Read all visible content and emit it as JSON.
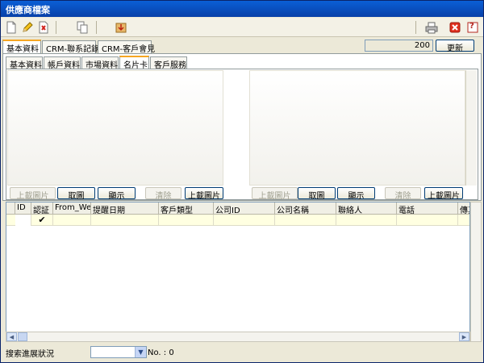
{
  "window": {
    "title": "供應商檔案"
  },
  "toolbar": {
    "icons": [
      "new-document-icon",
      "edit-pencil-icon",
      "delete-doc-icon",
      "copy-icon",
      "import-icon",
      "print-icon",
      "close-icon",
      "help-icon"
    ],
    "help_glyph": "?"
  },
  "top_tabs": [
    {
      "label": "基本資料",
      "active": true
    },
    {
      "label": "CRM-聯系記錄",
      "active": false
    },
    {
      "label": "CRM-客戶會見",
      "active": false
    }
  ],
  "top_field": {
    "value": "200"
  },
  "top_refresh_label": "更新",
  "inner_tabs": [
    {
      "label": "基本資料",
      "active": false
    },
    {
      "label": "帳戶資料",
      "active": false
    },
    {
      "label": "市場資料",
      "active": false
    },
    {
      "label": "名片卡",
      "active": true
    },
    {
      "label": "客戶服務",
      "active": false
    }
  ],
  "card_buttons": {
    "upload_disabled": "上載圖片",
    "retrieve": "取圖",
    "show": "顯示",
    "clear": "清除",
    "upload": "上載圖片"
  },
  "grid": {
    "columns": [
      "ID",
      "認証",
      "From_Web",
      "提醒日期",
      "客戶類型",
      "公司ID",
      "公司名稱",
      "聯絡人",
      "電話",
      "傳真"
    ],
    "rows": [
      {
        "id": "",
        "verified": "✔",
        "from_web": "",
        "remind_date": "",
        "client_type": "",
        "company_id": "",
        "company_name": "",
        "contact": "",
        "phone": "",
        "fax": ""
      }
    ]
  },
  "footer": {
    "status_label": "搜索進展狀況",
    "status_value": "",
    "no_label": "No. : 0"
  }
}
